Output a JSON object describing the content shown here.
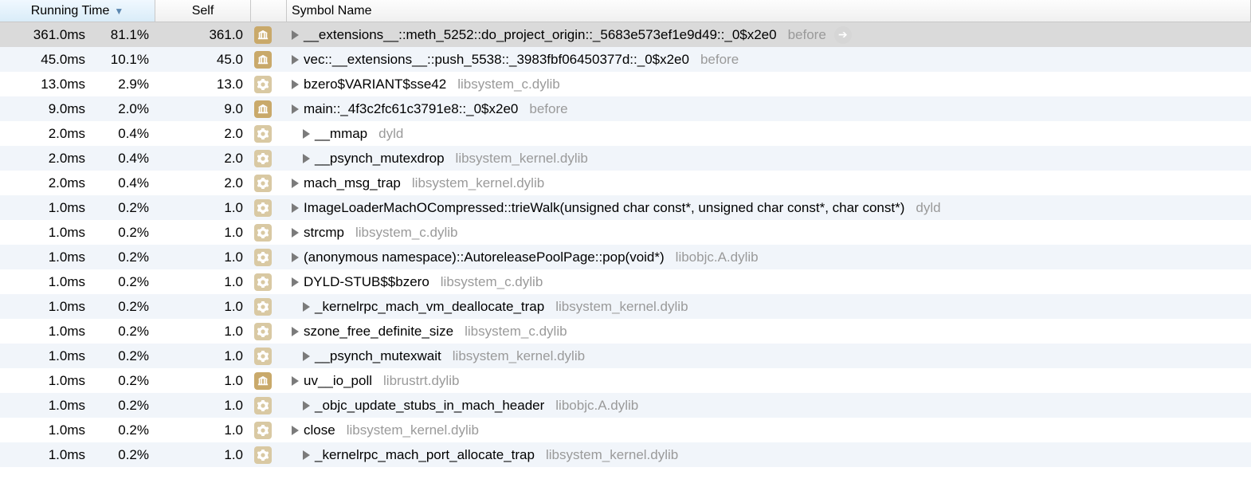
{
  "headers": {
    "running_time": "Running Time",
    "self": "Self",
    "symbol_name": "Symbol Name"
  },
  "rows": [
    {
      "ms": "361.0ms",
      "pct": "81.1%",
      "self": "361.0",
      "icon": "app",
      "disclosure": true,
      "symbol": "__extensions__::meth_5252::do_project_origin::_5683e573ef1e9d49::_0$x2e0",
      "lib": "before",
      "selected": true,
      "focus": true
    },
    {
      "ms": "45.0ms",
      "pct": "10.1%",
      "self": "45.0",
      "icon": "app",
      "disclosure": true,
      "symbol": "vec::__extensions__::push_5538::_3983fbf06450377d::_0$x2e0",
      "lib": "before"
    },
    {
      "ms": "13.0ms",
      "pct": "2.9%",
      "self": "13.0",
      "icon": "sys",
      "disclosure": true,
      "symbol": "bzero$VARIANT$sse42",
      "lib": "libsystem_c.dylib"
    },
    {
      "ms": "9.0ms",
      "pct": "2.0%",
      "self": "9.0",
      "icon": "app",
      "disclosure": true,
      "symbol": "main::_4f3c2fc61c3791e8::_0$x2e0",
      "lib": "before"
    },
    {
      "ms": "2.0ms",
      "pct": "0.4%",
      "self": "2.0",
      "icon": "sys",
      "disclosure": true,
      "indent": true,
      "symbol": "__mmap",
      "lib": "dyld"
    },
    {
      "ms": "2.0ms",
      "pct": "0.4%",
      "self": "2.0",
      "icon": "sys",
      "disclosure": true,
      "indent": true,
      "symbol": "__psynch_mutexdrop",
      "lib": "libsystem_kernel.dylib"
    },
    {
      "ms": "2.0ms",
      "pct": "0.4%",
      "self": "2.0",
      "icon": "sys",
      "disclosure": true,
      "symbol": "mach_msg_trap",
      "lib": "libsystem_kernel.dylib"
    },
    {
      "ms": "1.0ms",
      "pct": "0.2%",
      "self": "1.0",
      "icon": "sys",
      "disclosure": true,
      "symbol": "ImageLoaderMachOCompressed::trieWalk(unsigned char const*, unsigned char const*, char const*)",
      "lib": "dyld"
    },
    {
      "ms": "1.0ms",
      "pct": "0.2%",
      "self": "1.0",
      "icon": "sys",
      "disclosure": true,
      "symbol": "strcmp",
      "lib": "libsystem_c.dylib"
    },
    {
      "ms": "1.0ms",
      "pct": "0.2%",
      "self": "1.0",
      "icon": "sys",
      "disclosure": true,
      "symbol": "(anonymous namespace)::AutoreleasePoolPage::pop(void*)",
      "lib": "libobjc.A.dylib"
    },
    {
      "ms": "1.0ms",
      "pct": "0.2%",
      "self": "1.0",
      "icon": "sys",
      "disclosure": true,
      "symbol": "DYLD-STUB$$bzero",
      "lib": "libsystem_c.dylib"
    },
    {
      "ms": "1.0ms",
      "pct": "0.2%",
      "self": "1.0",
      "icon": "sys",
      "disclosure": true,
      "indent": true,
      "symbol": "_kernelrpc_mach_vm_deallocate_trap",
      "lib": "libsystem_kernel.dylib"
    },
    {
      "ms": "1.0ms",
      "pct": "0.2%",
      "self": "1.0",
      "icon": "sys",
      "disclosure": true,
      "symbol": "szone_free_definite_size",
      "lib": "libsystem_c.dylib"
    },
    {
      "ms": "1.0ms",
      "pct": "0.2%",
      "self": "1.0",
      "icon": "sys",
      "disclosure": true,
      "indent": true,
      "symbol": "__psynch_mutexwait",
      "lib": "libsystem_kernel.dylib"
    },
    {
      "ms": "1.0ms",
      "pct": "0.2%",
      "self": "1.0",
      "icon": "app",
      "disclosure": true,
      "symbol": "uv__io_poll",
      "lib": "librustrt.dylib"
    },
    {
      "ms": "1.0ms",
      "pct": "0.2%",
      "self": "1.0",
      "icon": "sys",
      "disclosure": true,
      "indent": true,
      "symbol": "_objc_update_stubs_in_mach_header",
      "lib": "libobjc.A.dylib"
    },
    {
      "ms": "1.0ms",
      "pct": "0.2%",
      "self": "1.0",
      "icon": "sys",
      "disclosure": true,
      "symbol": "close",
      "lib": "libsystem_kernel.dylib"
    },
    {
      "ms": "1.0ms",
      "pct": "0.2%",
      "self": "1.0",
      "icon": "sys",
      "disclosure": true,
      "indent": true,
      "symbol": "_kernelrpc_mach_port_allocate_trap",
      "lib": "libsystem_kernel.dylib"
    }
  ]
}
